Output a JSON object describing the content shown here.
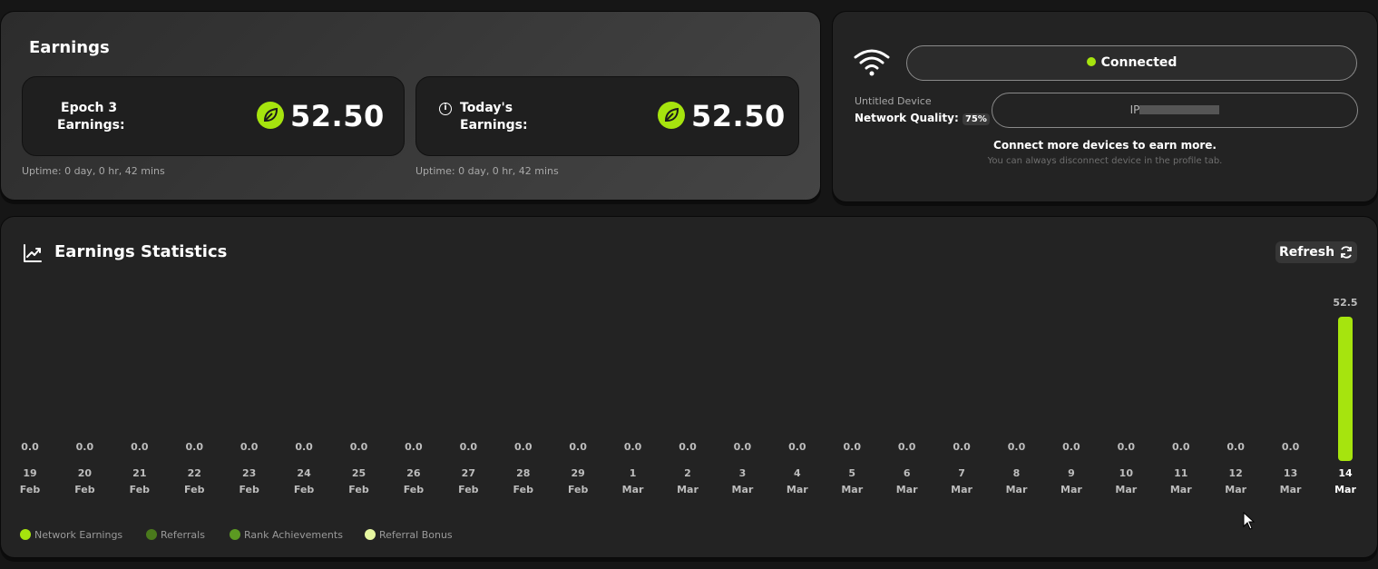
{
  "earnings": {
    "title": "Earnings",
    "epoch": {
      "label_line1": "Epoch 3",
      "label_line2": "Earnings:",
      "value": "52.50",
      "uptime": "Uptime: 0 day, 0 hr, 42 mins"
    },
    "today": {
      "label_line1": "Today's",
      "label_line2": "Earnings:",
      "value": "52.50",
      "uptime": "Uptime: 0 day, 0 hr, 42 mins"
    }
  },
  "device": {
    "status": "Connected",
    "status_color": "#a6e40e",
    "name": "Untitled Device",
    "quality_label": "Network Quality:",
    "quality_value": "75%",
    "ip_label": "IP",
    "cta_title": "Connect more devices to earn more.",
    "cta_subtitle": "You can always disconnect device in the profile tab."
  },
  "stats": {
    "title": "Earnings Statistics",
    "refresh_label": "Refresh"
  },
  "chart_data": {
    "type": "bar",
    "categories": [
      "19 Feb",
      "20 Feb",
      "21 Feb",
      "22 Feb",
      "23 Feb",
      "24 Feb",
      "25 Feb",
      "26 Feb",
      "27 Feb",
      "28 Feb",
      "29 Feb",
      "1 Mar",
      "2 Mar",
      "3 Mar",
      "4 Mar",
      "5 Mar",
      "6 Mar",
      "7 Mar",
      "8 Mar",
      "9 Mar",
      "10 Mar",
      "11 Mar",
      "12 Mar",
      "13 Mar",
      "14 Mar"
    ],
    "day_labels": [
      "19",
      "20",
      "21",
      "22",
      "23",
      "24",
      "25",
      "26",
      "27",
      "28",
      "29",
      "1",
      "2",
      "3",
      "4",
      "5",
      "6",
      "7",
      "8",
      "9",
      "10",
      "11",
      "12",
      "13",
      "14"
    ],
    "month_labels": [
      "Feb",
      "Feb",
      "Feb",
      "Feb",
      "Feb",
      "Feb",
      "Feb",
      "Feb",
      "Feb",
      "Feb",
      "Feb",
      "Mar",
      "Mar",
      "Mar",
      "Mar",
      "Mar",
      "Mar",
      "Mar",
      "Mar",
      "Mar",
      "Mar",
      "Mar",
      "Mar",
      "Mar",
      "Mar"
    ],
    "values": [
      0,
      0,
      0,
      0,
      0,
      0,
      0,
      0,
      0,
      0,
      0,
      0,
      0,
      0,
      0,
      0,
      0,
      0,
      0,
      0,
      0,
      0,
      0,
      0,
      52.5
    ],
    "value_labels": [
      "0.0",
      "0.0",
      "0.0",
      "0.0",
      "0.0",
      "0.0",
      "0.0",
      "0.0",
      "0.0",
      "0.0",
      "0.0",
      "0.0",
      "0.0",
      "0.0",
      "0.0",
      "0.0",
      "0.0",
      "0.0",
      "0.0",
      "0.0",
      "0.0",
      "0.0",
      "0.0",
      "0.0",
      "52.5"
    ],
    "ylim": [
      0,
      52.5
    ],
    "bar_color": "#a6e40e",
    "legend": [
      {
        "name": "Network Earnings",
        "color": "#a6e40e"
      },
      {
        "name": "Referrals",
        "color": "#4a7a1c"
      },
      {
        "name": "Rank Achievements",
        "color": "#5c9a22"
      },
      {
        "name": "Referral Bonus",
        "color": "#e6f7a0"
      }
    ]
  }
}
